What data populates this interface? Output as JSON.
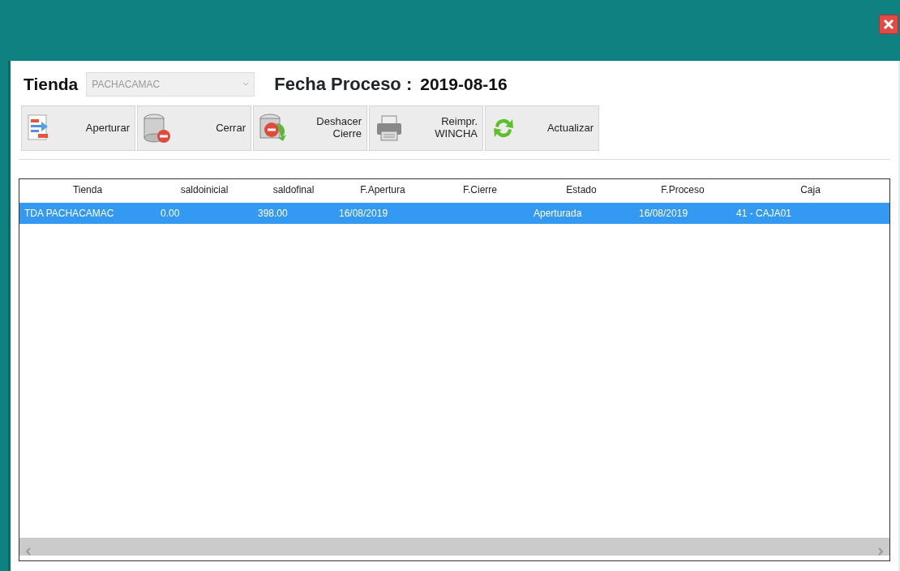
{
  "filter": {
    "store_label": "Tienda",
    "store_select": {
      "value": "PACHACAMAC",
      "disabled": true
    },
    "date_label": "Fecha Proceso :",
    "date_value": "2019-08-16"
  },
  "toolbar": [
    {
      "kind": "open",
      "lines": [
        "Aperturar"
      ]
    },
    {
      "kind": "close",
      "lines": [
        "Cerrar"
      ]
    },
    {
      "kind": "undo",
      "lines": [
        "Deshacer",
        "Cierre"
      ]
    },
    {
      "kind": "print",
      "lines": [
        "Reimpr.",
        "WINCHA"
      ]
    },
    {
      "kind": "refresh",
      "lines": [
        "Actualizar"
      ]
    }
  ],
  "table": {
    "columns": [
      "Tienda",
      "saldoinicial",
      "saldofinal",
      "F.Apertura",
      "F.Cierre",
      "Estado",
      "F.Proceso",
      "Caja"
    ],
    "rows": [
      {
        "selected": true,
        "cells": [
          "TDA PACHACAMAC",
          "0.00",
          "398.00",
          "16/08/2019",
          "",
          "Aperturada",
          "16/08/2019",
          "41 - CAJA01"
        ]
      }
    ]
  }
}
